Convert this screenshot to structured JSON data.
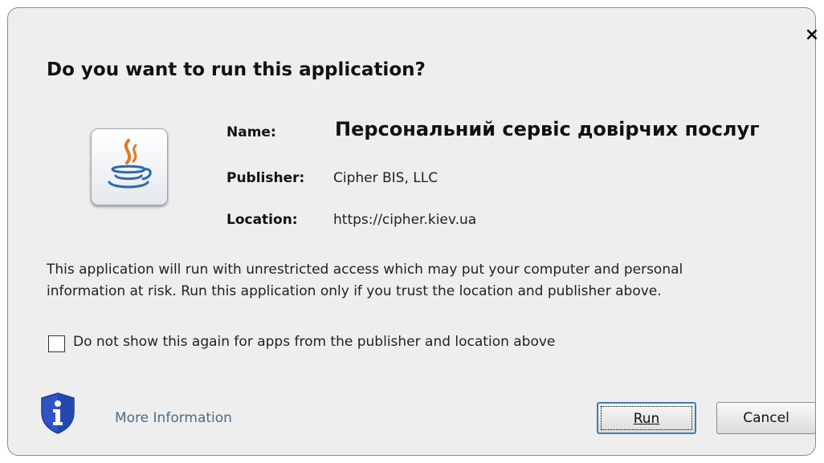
{
  "dialog": {
    "close_glyph": "×",
    "title": "Do you want to run this application?",
    "app_icon": "java-icon",
    "fields": {
      "name_label": "Name:",
      "name_value": "Персональний сервіс довірчих послуг",
      "publisher_label": "Publisher:",
      "publisher_value": "Cipher BIS, LLC",
      "location_label": "Location:",
      "location_value": "https://cipher.kiev.ua"
    },
    "warning_lines": [
      "This application will run with unrestricted access which may put your computer and personal",
      "information at risk. Run this application only if you trust the location and publisher above."
    ],
    "checkbox": {
      "label": "Do not show this again for apps from the publisher and location above",
      "checked": false
    },
    "footer": {
      "shield_icon": "info-shield-icon",
      "more_info_label": "More Information",
      "run_label": "Run",
      "cancel_label": "Cancel"
    }
  },
  "colors": {
    "dialog_background": "#eeeeee",
    "link": "#4a6b8a",
    "default_button_border": "#3c7fb1",
    "shield_blue": "#2f55c4",
    "java_orange": "#e07a1f",
    "java_blue": "#2a6aa8"
  }
}
